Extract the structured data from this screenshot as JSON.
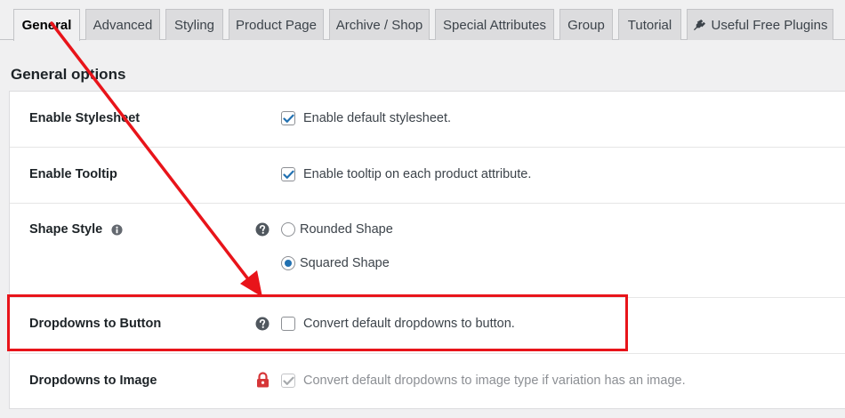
{
  "tabs": [
    {
      "label": "General",
      "active": true
    },
    {
      "label": "Advanced"
    },
    {
      "label": "Styling"
    },
    {
      "label": "Product Page"
    },
    {
      "label": "Archive / Shop"
    },
    {
      "label": "Special Attributes"
    },
    {
      "label": "Group"
    },
    {
      "label": "Tutorial"
    },
    {
      "label": "Useful Free Plugins",
      "icon": "plug-icon"
    }
  ],
  "section_title": "General options",
  "rows": {
    "stylesheet": {
      "label": "Enable Stylesheet",
      "checkbox_label": "Enable default stylesheet.",
      "checked": true
    },
    "tooltip": {
      "label": "Enable Tooltip",
      "checkbox_label": "Enable tooltip on each product attribute.",
      "checked": true
    },
    "shape": {
      "label": "Shape Style",
      "options": [
        {
          "label": "Rounded Shape",
          "selected": false
        },
        {
          "label": "Squared Shape",
          "selected": true
        }
      ]
    },
    "dropdown_button": {
      "label": "Dropdowns to Button",
      "checkbox_label": "Convert default dropdowns to button.",
      "checked": false
    },
    "dropdown_image": {
      "label": "Dropdowns to Image",
      "checkbox_label": "Convert default dropdowns to image type if variation has an image.",
      "checked": true,
      "disabled": true
    }
  },
  "colors": {
    "accent": "#2271b1",
    "annotation": "#e8141a",
    "lock": "#d63638",
    "help": "#50575e"
  }
}
